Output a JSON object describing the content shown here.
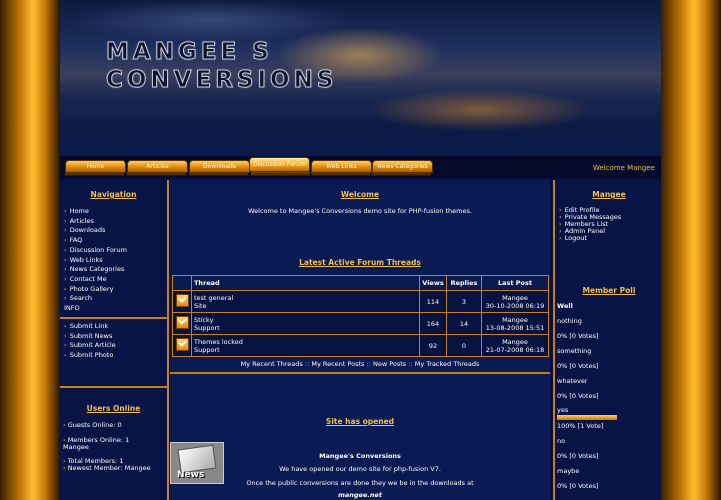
{
  "site": {
    "logo_line1": "MANGEE S",
    "logo_line2": "CONVERSIONS"
  },
  "nav_tabs": [
    {
      "label": "Home"
    },
    {
      "label": "Articles"
    },
    {
      "label": "Downloads"
    },
    {
      "label": "Discussion Forum",
      "active": true
    },
    {
      "label": "Web Links"
    },
    {
      "label": "News Categories"
    }
  ],
  "welcome_user": "Welcome Mangee",
  "navigation": {
    "title": "Navigation",
    "items": [
      "Home",
      "Articles",
      "Downloads",
      "FAQ",
      "Discussion Forum",
      "Web Links",
      "News Categories",
      "Contact Me",
      "Photo Gallery",
      "Search"
    ],
    "info_label": "INFO",
    "submit_items": [
      "Submit Link",
      "Submit News",
      "Submit Article",
      "Submit Photo"
    ]
  },
  "users_online": {
    "title": "Users Online",
    "guests": "Guests Online: 0",
    "members": "Members Online: 1",
    "member_name": "Mangee",
    "total": "Total Members: 1",
    "newest": "Newest Member: Mangee"
  },
  "welcome": {
    "title": "Welcome",
    "text": "Welcome to Mangee's Conversions demo site for PHP-fusion themes."
  },
  "forum": {
    "title": "Latest Active Forum Threads",
    "headers": {
      "thread": "Thread",
      "views": "Views",
      "replies": "Replies",
      "last_post": "Last Post"
    },
    "rows": [
      {
        "thread": "test general",
        "forum": "Site",
        "views": "114",
        "replies": "3",
        "user": "Mangee",
        "date": "30-10-2008 06:19"
      },
      {
        "thread": "Sticky",
        "forum": "Support",
        "views": "164",
        "replies": "14",
        "user": "Mangee",
        "date": "13-08-2008 15:51"
      },
      {
        "thread": "Themes locked",
        "forum": "Support",
        "views": "92",
        "replies": "0",
        "user": "Mangee",
        "date": "21-07-2008 06:18"
      }
    ],
    "links": [
      "My Recent Threads",
      "My Recent Posts",
      "New Posts",
      "My Tracked Threads"
    ],
    "link_sep": "::"
  },
  "news": {
    "title": "Site has opened",
    "image_label": "News",
    "heading": "Mangee's Conversions",
    "line1": "We have opened our demo site for php-fusion V7.",
    "line2": "Once the public conversions are done they we be in the downloads at",
    "line3": "mangee.net"
  },
  "user_panel": {
    "title": "Mangee",
    "items": [
      "Edit Profile",
      "Private Messages",
      "Members List",
      "Admin Panel",
      "Logout"
    ]
  },
  "poll": {
    "title": "Member Poll",
    "question": "Well",
    "options": [
      {
        "label": "nothing",
        "result": "0% [0 Votes]",
        "percent": 0
      },
      {
        "label": "something",
        "result": "0% [0 Votes]",
        "percent": 0
      },
      {
        "label": "whatever",
        "result": "0% [0 Votes]",
        "percent": 0
      },
      {
        "label": "yes",
        "result": "100% [1 Vote]",
        "percent": 100
      },
      {
        "label": "no",
        "result": "0% [0 Votes]",
        "percent": 0
      },
      {
        "label": "maybe",
        "result": "0% [0 Votes]",
        "percent": 0
      }
    ]
  }
}
